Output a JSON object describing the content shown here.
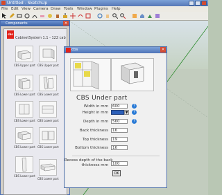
{
  "app": {
    "title": "Untitled - SketchUp",
    "menus": [
      "File",
      "Edit",
      "View",
      "Camera",
      "Draw",
      "Tools",
      "Window",
      "Plugins",
      "Help"
    ]
  },
  "components_panel": {
    "title": "Components",
    "close": "×",
    "logo": "cbs",
    "brand": "CabinetSystem 1.1 - 122 cab",
    "items": [
      "CBS Upper part",
      "CBS Upper part",
      "CBS Lower part",
      "CBS Lower part",
      "CBS Lower part",
      "CBS Lower part",
      "CBS Lower part",
      "CBS Lower part",
      "CBS Lower part",
      "CBS Lower part"
    ]
  },
  "dialog": {
    "title": "cbs",
    "close": "×",
    "heading": "CBS Under part",
    "fields": [
      {
        "label": "Width in mm",
        "value": "600",
        "help": true
      },
      {
        "label": "Height in mm",
        "value": "",
        "help": true,
        "select": true
      },
      {
        "label": "Depth in mm",
        "value": "560",
        "help": true
      },
      {
        "label": "Back thickness",
        "value": "16",
        "help": false
      },
      {
        "label": "Top thickness",
        "value": "19",
        "help": false
      },
      {
        "label": "Bottom thickness",
        "value": "16",
        "help": false
      }
    ],
    "extra_label_1": "Recess depth of the back",
    "extra_label_2": "thickness mm",
    "extra_value": "100",
    "ok_label": "OK"
  }
}
